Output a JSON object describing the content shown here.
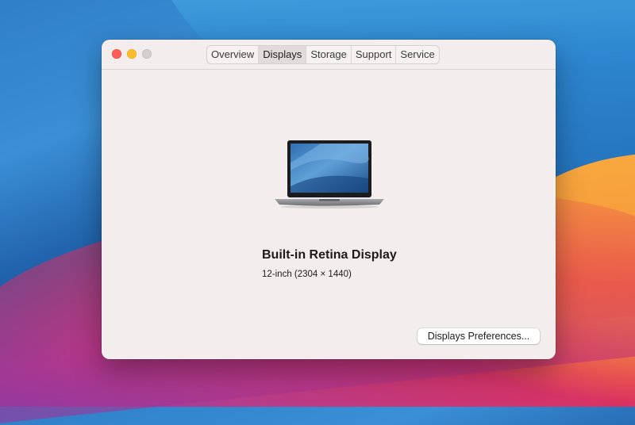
{
  "tabs": [
    {
      "label": "Overview",
      "active": false
    },
    {
      "label": "Displays",
      "active": true
    },
    {
      "label": "Storage",
      "active": false
    },
    {
      "label": "Support",
      "active": false
    },
    {
      "label": "Service",
      "active": false
    }
  ],
  "display": {
    "name": "Built-in Retina Display",
    "size": "12-inch (2304 × 1440)"
  },
  "buttons": {
    "preferences": "Displays Preferences..."
  },
  "colors": {
    "window_bg": "#f4eded",
    "close": "#fe5f57",
    "minimize": "#febc2e",
    "zoom_inactive": "#d4cfcf"
  },
  "icons": {
    "window_controls": [
      "close-icon",
      "minimize-icon",
      "zoom-icon"
    ],
    "display": "macbook-laptop-icon"
  }
}
